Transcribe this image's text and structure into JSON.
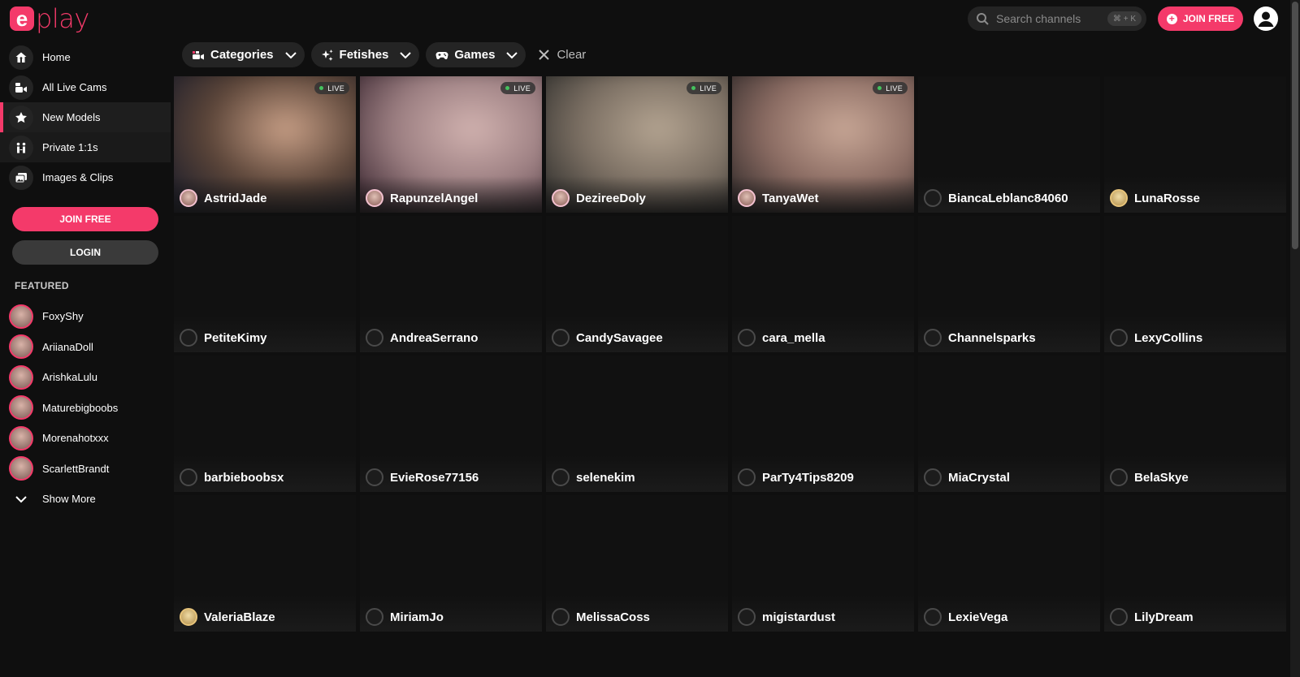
{
  "brand": {
    "logo_letter": "e",
    "logo_text": "play",
    "accent": "#f43a6a"
  },
  "nav": [
    {
      "id": "home",
      "label": "Home",
      "icon": "home-icon"
    },
    {
      "id": "all-live-cams",
      "label": "All Live Cams",
      "icon": "live-cam-icon"
    },
    {
      "id": "new-models",
      "label": "New Models",
      "icon": "star-icon",
      "active": true
    },
    {
      "id": "private",
      "label": "Private 1:1s",
      "icon": "private-icon"
    },
    {
      "id": "images-clips",
      "label": "Images & Clips",
      "icon": "images-icon"
    }
  ],
  "sidebar_buttons": {
    "join": "JOIN FREE",
    "login": "LOGIN"
  },
  "featured": {
    "title": "FEATURED",
    "items": [
      "FoxyShy",
      "AriianaDoll",
      "ArishkaLulu",
      "Maturebigboobs",
      "Morenahotxxx",
      "ScarlettBrandt"
    ],
    "show_more": "Show More"
  },
  "header": {
    "search_placeholder": "Search channels",
    "shortcut": "⌘ + K",
    "join": "JOIN FREE"
  },
  "filters": {
    "categories": "Categories",
    "fetishes": "Fetishes",
    "games": "Games",
    "clear": "Clear"
  },
  "live_label": "LIVE",
  "channels": [
    {
      "name": "AstridJade",
      "live": true,
      "avatar": "photo",
      "tint": [
        "#1a1c2a",
        "#5a4438",
        "#c9a087"
      ]
    },
    {
      "name": "RapunzelAngel",
      "live": true,
      "avatar": "photo",
      "tint": [
        "#3a2630",
        "#9a7d80",
        "#d2b3b0"
      ]
    },
    {
      "name": "DezireeDoly",
      "live": true,
      "avatar": "photo",
      "tint": [
        "#2c2c2a",
        "#7a6e62",
        "#b5a592"
      ]
    },
    {
      "name": "TanyaWet",
      "live": true,
      "avatar": "photo",
      "tint": [
        "#2e2828",
        "#8a6b62",
        "#c9a897"
      ]
    },
    {
      "name": "BiancaLeblanc84060",
      "live": false,
      "avatar": "none"
    },
    {
      "name": "LunaRosse",
      "live": false,
      "avatar": "gold"
    },
    {
      "name": "PetiteKimy",
      "live": false,
      "avatar": "none"
    },
    {
      "name": "AndreaSerrano",
      "live": false,
      "avatar": "none"
    },
    {
      "name": "CandySavagee",
      "live": false,
      "avatar": "none"
    },
    {
      "name": "cara_mella",
      "live": false,
      "avatar": "none"
    },
    {
      "name": "Channelsparks",
      "live": false,
      "avatar": "none"
    },
    {
      "name": "LexyCollins",
      "live": false,
      "avatar": "none"
    },
    {
      "name": "barbieboobsx",
      "live": false,
      "avatar": "none"
    },
    {
      "name": "EvieRose77156",
      "live": false,
      "avatar": "none"
    },
    {
      "name": "selenekim",
      "live": false,
      "avatar": "none"
    },
    {
      "name": "ParTy4Tips8209",
      "live": false,
      "avatar": "none"
    },
    {
      "name": "MiaCrystal",
      "live": false,
      "avatar": "none"
    },
    {
      "name": "BelaSkye",
      "live": false,
      "avatar": "none"
    },
    {
      "name": "ValeriaBlaze",
      "live": false,
      "avatar": "gold"
    },
    {
      "name": "MiriamJo",
      "live": false,
      "avatar": "none"
    },
    {
      "name": "MelissaCoss",
      "live": false,
      "avatar": "none"
    },
    {
      "name": "migistardust",
      "live": false,
      "avatar": "none"
    },
    {
      "name": "LexieVega",
      "live": false,
      "avatar": "none"
    },
    {
      "name": "LilyDream",
      "live": false,
      "avatar": "none"
    }
  ]
}
